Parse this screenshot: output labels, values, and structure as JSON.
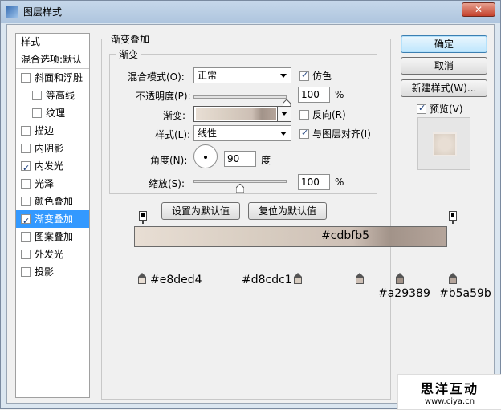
{
  "window": {
    "title": "图层样式",
    "close_glyph": "✕"
  },
  "styles_panel": {
    "header": "样式",
    "blend_options": "混合选项:默认",
    "items": [
      {
        "label": "斜面和浮雕",
        "checked": false,
        "sub": false,
        "selected": false
      },
      {
        "label": "等高线",
        "checked": false,
        "sub": true,
        "selected": false
      },
      {
        "label": "纹理",
        "checked": false,
        "sub": true,
        "selected": false
      },
      {
        "label": "描边",
        "checked": false,
        "sub": false,
        "selected": false
      },
      {
        "label": "内阴影",
        "checked": false,
        "sub": false,
        "selected": false
      },
      {
        "label": "内发光",
        "checked": true,
        "sub": false,
        "selected": false
      },
      {
        "label": "光泽",
        "checked": false,
        "sub": false,
        "selected": false
      },
      {
        "label": "颜色叠加",
        "checked": false,
        "sub": false,
        "selected": false
      },
      {
        "label": "渐变叠加",
        "checked": true,
        "sub": false,
        "selected": true
      },
      {
        "label": "图案叠加",
        "checked": false,
        "sub": false,
        "selected": false
      },
      {
        "label": "外发光",
        "checked": false,
        "sub": false,
        "selected": false
      },
      {
        "label": "投影",
        "checked": false,
        "sub": false,
        "selected": false
      }
    ]
  },
  "gradient_overlay": {
    "group_title": "渐变叠加",
    "subgroup_title": "渐变",
    "blend_mode_label": "混合模式(O):",
    "blend_mode_value": "正常",
    "dither_label": "仿色",
    "dither_checked": true,
    "opacity_label": "不透明度(P):",
    "opacity_value": "100",
    "opacity_level": 1.0,
    "percent": "%",
    "gradient_label": "渐变:",
    "reverse_label": "反向(R)",
    "reverse_checked": false,
    "style_label": "样式(L):",
    "style_value": "线性",
    "align_label": "与图层对齐(I)",
    "align_checked": true,
    "angle_label": "角度(N):",
    "angle_value": "90",
    "degree": "度",
    "scale_label": "缩放(S):",
    "scale_value": "100",
    "scale_level": 0.5,
    "set_default": "设置为默认值",
    "reset_default": "复位为默认值"
  },
  "buttons": {
    "ok": "确定",
    "cancel": "取消",
    "new_style": "新建样式(W)...",
    "preview_label": "预览(V)",
    "preview_checked": true
  },
  "gradient_bar": {
    "center_label": "#cdbfb5",
    "stops": [
      {
        "label": "#e8ded4",
        "color": "#e8ded4"
      },
      {
        "label": "#d8cdc1",
        "color": "#d8cdc1"
      },
      {
        "label": "",
        "color": "#cdbfb5"
      },
      {
        "label": "#a29389",
        "color": "#a29389"
      },
      {
        "label": "#b5a59b",
        "color": "#b5a59b"
      }
    ]
  },
  "watermark": {
    "main": "思洋互动",
    "sub": "www.ciya.cn"
  }
}
